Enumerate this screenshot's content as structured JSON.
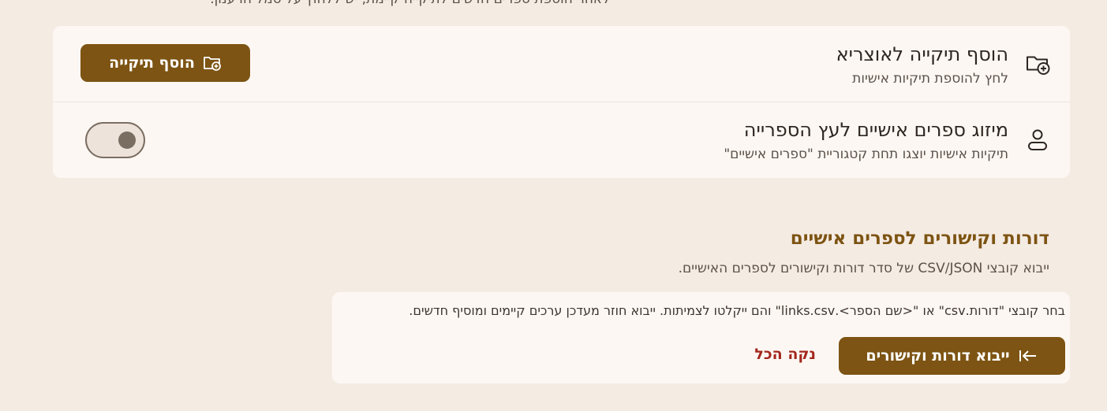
{
  "top_note": "לאחר הוספת ספרים חדשים לתיקייה קיימת, יש ללחוץ על סמל הרענון.",
  "add_folder": {
    "title": "הוסף תיקייה לאוצריא",
    "subtitle": "לחץ להוספת תיקיות אישיות",
    "button_label": "הוסף תיקייה"
  },
  "merge_books": {
    "title": "מיזוג ספרים אישיים לעץ הספרייה",
    "subtitle": "תיקיות אישיות יוצגו תחת קטגוריית \"ספרים אישיים\"",
    "toggle_on": false
  },
  "generations_section": {
    "title": "דורות וקישורים לספרים אישיים",
    "description": "ייבוא קובצי CSV/JSON של סדר דורות וקישורים לספרים האישיים.",
    "instructions": "בחר קובצי \"דורות.csv\" או \"<שם הספר>.links.csv\" והם ייקלטו לצמיתות. ייבוא חוזר מעדכן ערכים קיימים ומוסיף חדשים.",
    "import_label": "ייבוא דורות וקישורים",
    "clear_label": "נקה הכל"
  },
  "colors": {
    "accent": "#7D5413",
    "danger": "#A3261C",
    "background": "#F4EBE3",
    "card": "#FDF7F3"
  }
}
